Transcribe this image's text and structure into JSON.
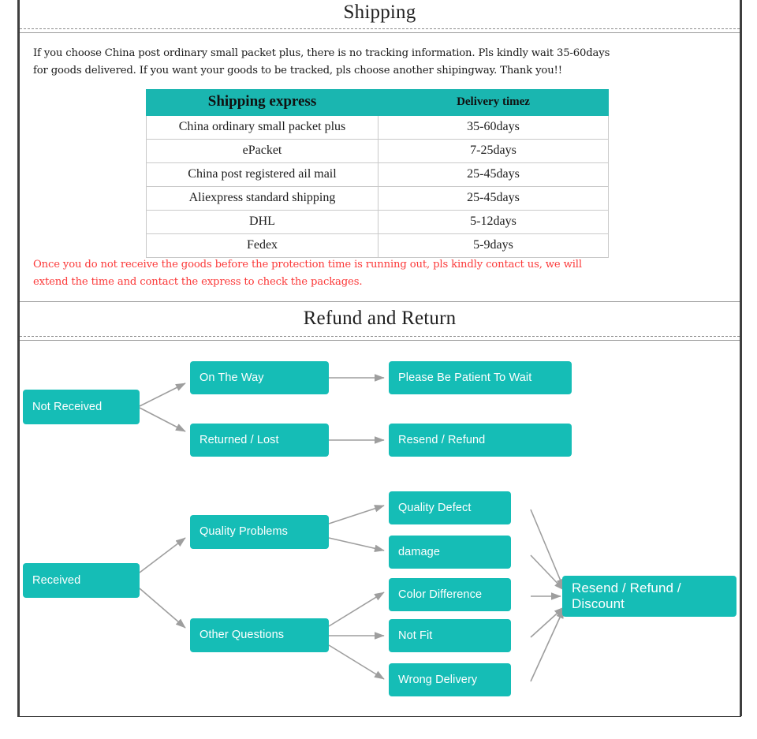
{
  "sections": {
    "shipping": {
      "title": "Shipping",
      "intro": "If you choose China post ordinary small packet plus, there is no tracking information. Pls kindly wait 35-60days\nfor goods delivered. If you want your goods to be tracked, pls choose another shipingway. Thank you!!",
      "warning": "Once you do not receive the goods before the protection time is running out, pls kindly contact us, we will\nextend the time and contact the express to check the packages.",
      "warning_color": "#fb3a3a",
      "table": {
        "headers": [
          "Shipping express",
          "Delivery timez"
        ],
        "rows": [
          [
            "China ordinary small packet plus",
            "35-60days"
          ],
          [
            "ePacket",
            "7-25days"
          ],
          [
            "China post registered ail mail",
            "25-45days"
          ],
          [
            "Aliexpress standard shipping",
            "25-45days"
          ],
          [
            "DHL",
            "5-12days"
          ],
          [
            "Fedex",
            "5-9days"
          ]
        ],
        "header_bg": "#1ab6b0"
      }
    },
    "refund": {
      "title": "Refund and Return",
      "accent": "#15bdb6",
      "arrow_color": "#9e9e9e",
      "flow": {
        "not_received": "Not Received",
        "on_the_way": "On The Way",
        "returned_lost": "Returned / Lost",
        "please_wait": "Please Be Patient To Wait",
        "resend_refund": "Resend / Refund",
        "received": "Received",
        "quality_problems": "Quality Problems",
        "other_questions": "Other Questions",
        "quality_defect": "Quality Defect",
        "damage": "damage",
        "color_difference": "Color Difference",
        "not_fit": "Not Fit",
        "wrong_delivery": "Wrong Delivery",
        "resend_refund_discount": "Resend / Refund / Discount"
      }
    }
  }
}
